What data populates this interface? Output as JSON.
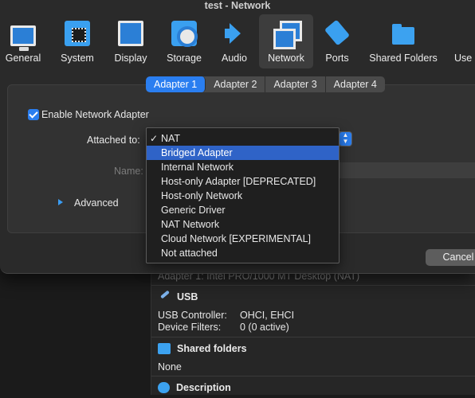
{
  "window": {
    "title": "test - Network"
  },
  "toolbar": {
    "items": [
      {
        "label": "General",
        "icon": "monitor-icon"
      },
      {
        "label": "System",
        "icon": "chip-icon"
      },
      {
        "label": "Display",
        "icon": "display-icon"
      },
      {
        "label": "Storage",
        "icon": "disk-icon"
      },
      {
        "label": "Audio",
        "icon": "speaker-icon"
      },
      {
        "label": "Network",
        "icon": "network-icon",
        "selected": true
      },
      {
        "label": "Ports",
        "icon": "port-icon"
      },
      {
        "label": "Shared Folders",
        "icon": "folder-icon"
      },
      {
        "label": "Use",
        "icon": "user-icon"
      }
    ]
  },
  "tabs": [
    {
      "label": "Adapter 1",
      "active": true
    },
    {
      "label": "Adapter 2"
    },
    {
      "label": "Adapter 3"
    },
    {
      "label": "Adapter 4"
    }
  ],
  "form": {
    "enable_label": "Enable Network Adapter",
    "enable_checked": true,
    "attached_label": "Attached to:",
    "name_label": "Name:",
    "advanced_label": "Advanced"
  },
  "menu": {
    "items": [
      {
        "label": "NAT",
        "checked": true,
        "check": "✓"
      },
      {
        "label": "Bridged Adapter",
        "highlighted": true
      },
      {
        "label": "Internal Network"
      },
      {
        "label": "Host-only Adapter [DEPRECATED]"
      },
      {
        "label": "Host-only Network"
      },
      {
        "label": "Generic Driver"
      },
      {
        "label": "NAT Network"
      },
      {
        "label": "Cloud Network [EXPERIMENTAL]"
      },
      {
        "label": "Not attached"
      }
    ]
  },
  "buttons": {
    "cancel": "Cancel"
  },
  "background": {
    "adapter_line": "Adapter 1:   Intel PRO/1000 MT Desktop (NAT)",
    "usb": {
      "title": "USB",
      "controller_label": "USB Controller:",
      "controller_value": "OHCI, EHCI",
      "filters_label": "Device Filters:",
      "filters_value": "0 (0 active)"
    },
    "shared": {
      "title": "Shared folders",
      "value": "None"
    },
    "description": {
      "title": "Description"
    }
  },
  "colors": {
    "accent": "#2a7ef0",
    "highlight": "#2f63c7",
    "dialog_bg": "#2a2a2a",
    "panel_bg": "#323232"
  }
}
